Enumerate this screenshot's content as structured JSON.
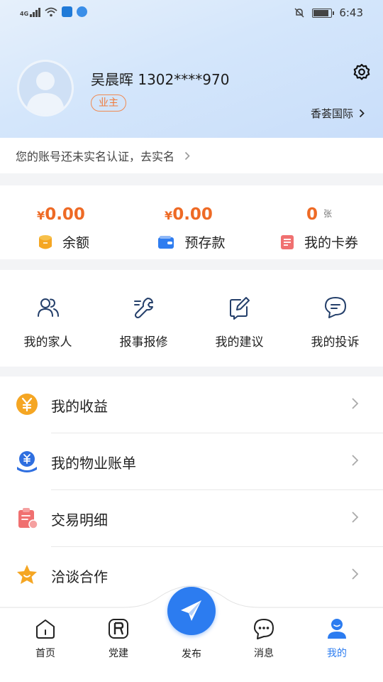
{
  "status_bar": {
    "network_tag": "4G",
    "time": "6:43"
  },
  "profile": {
    "name_phone": "吴晨晖 1302****970",
    "role": "业主",
    "community": "香荟国际"
  },
  "verify_notice": "您的账号还未实名认证，去实名",
  "assets": [
    {
      "currency": "¥",
      "amount": "0.00",
      "unit": "",
      "label": "余额",
      "icon": "coin-icon",
      "color": "#f5a623"
    },
    {
      "currency": "¥",
      "amount": "0.00",
      "unit": "",
      "label": "预存款",
      "icon": "wallet-icon",
      "color": "#2f7df0"
    },
    {
      "currency": "",
      "amount": "0",
      "unit": "张",
      "label": "我的卡券",
      "icon": "coupon-icon",
      "color": "#f07070"
    }
  ],
  "quick_actions": [
    {
      "label": "我的家人",
      "icon": "family-icon"
    },
    {
      "label": "报事报修",
      "icon": "repair-icon"
    },
    {
      "label": "我的建议",
      "icon": "suggestion-icon"
    },
    {
      "label": "我的投诉",
      "icon": "complaint-icon"
    }
  ],
  "menu": [
    {
      "label": "我的收益",
      "icon": "yen-icon",
      "color": "#f5a623"
    },
    {
      "label": "我的物业账单",
      "icon": "bill-icon",
      "color": "#2f6fe0"
    },
    {
      "label": "交易明细",
      "icon": "clipboard-icon",
      "color": "#f07070"
    },
    {
      "label": "洽谈合作",
      "icon": "star-icon",
      "color": "#f5a623"
    }
  ],
  "tabbar": [
    {
      "label": "首页",
      "icon": "home-icon"
    },
    {
      "label": "党建",
      "icon": "party-icon"
    },
    {
      "label": "发布",
      "icon": "send-icon"
    },
    {
      "label": "消息",
      "icon": "message-icon"
    },
    {
      "label": "我的",
      "icon": "user-icon",
      "active_color": "#2c7cf0"
    }
  ]
}
